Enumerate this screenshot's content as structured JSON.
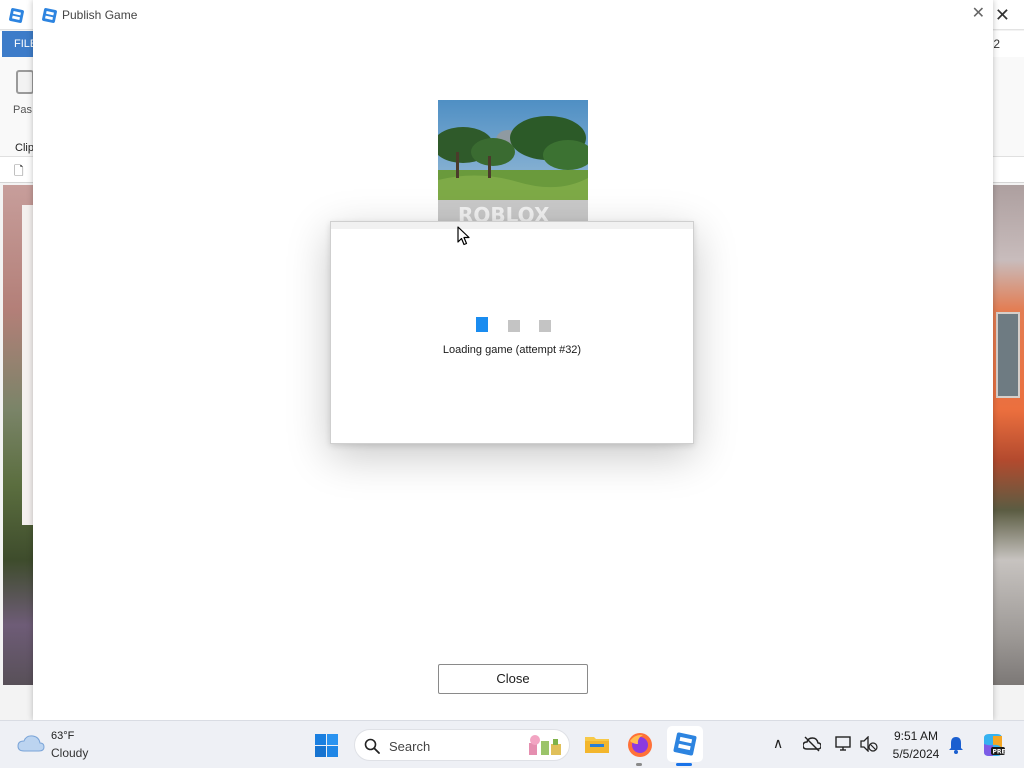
{
  "studio": {
    "file_tab": "FILE",
    "tab_number": "2",
    "paste_label": "Pas",
    "clipboard_label": "Clip"
  },
  "publish_dialog": {
    "title": "Publish Game",
    "loading_text": "Loading game (attempt #32)",
    "loading_step": 1,
    "loading_steps_total": 3,
    "close_button": "Close"
  },
  "taskbar": {
    "weather_temp": "63°F",
    "weather_desc": "Cloudy",
    "search_label": "Search",
    "time": "9:51 AM",
    "date": "5/5/2024"
  },
  "colors": {
    "accent": "#1a8cf0",
    "file_tab": "#3d7cc9",
    "taskbar_bg": "#eef0f5"
  }
}
